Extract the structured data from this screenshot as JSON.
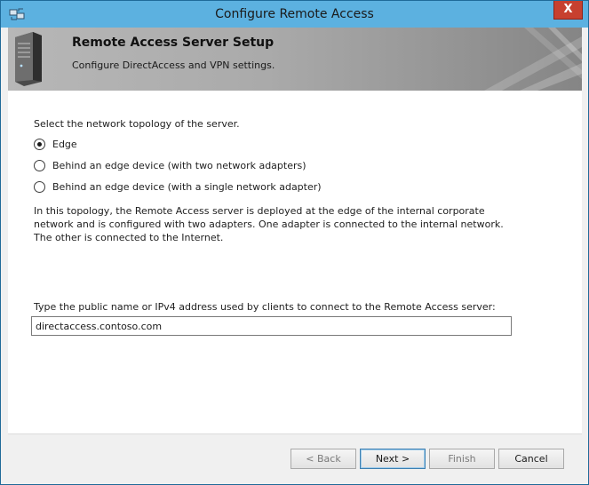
{
  "window": {
    "title": "Configure Remote Access",
    "close_label": "X"
  },
  "banner": {
    "title": "Remote Access Server Setup",
    "subtitle": "Configure DirectAccess and VPN settings."
  },
  "topology": {
    "prompt": "Select the network topology of the server.",
    "options": [
      {
        "label": "Edge",
        "selected": true
      },
      {
        "label": "Behind an edge device (with two network adapters)",
        "selected": false
      },
      {
        "label": "Behind an edge device (with a single network adapter)",
        "selected": false
      }
    ],
    "description": "In this topology, the Remote Access server is deployed at the edge of the internal corporate network and is configured with two adapters. One adapter is connected to the internal network. The other is connected to the Internet."
  },
  "public_name": {
    "label": "Type the public name or IPv4 address used by clients to connect to the Remote Access server:",
    "value": "directaccess.contoso.com"
  },
  "buttons": {
    "back": "< Back",
    "next": "Next >",
    "finish": "Finish",
    "cancel": "Cancel"
  },
  "icons": {
    "window": "remote-access-icon",
    "banner": "server-icon"
  }
}
